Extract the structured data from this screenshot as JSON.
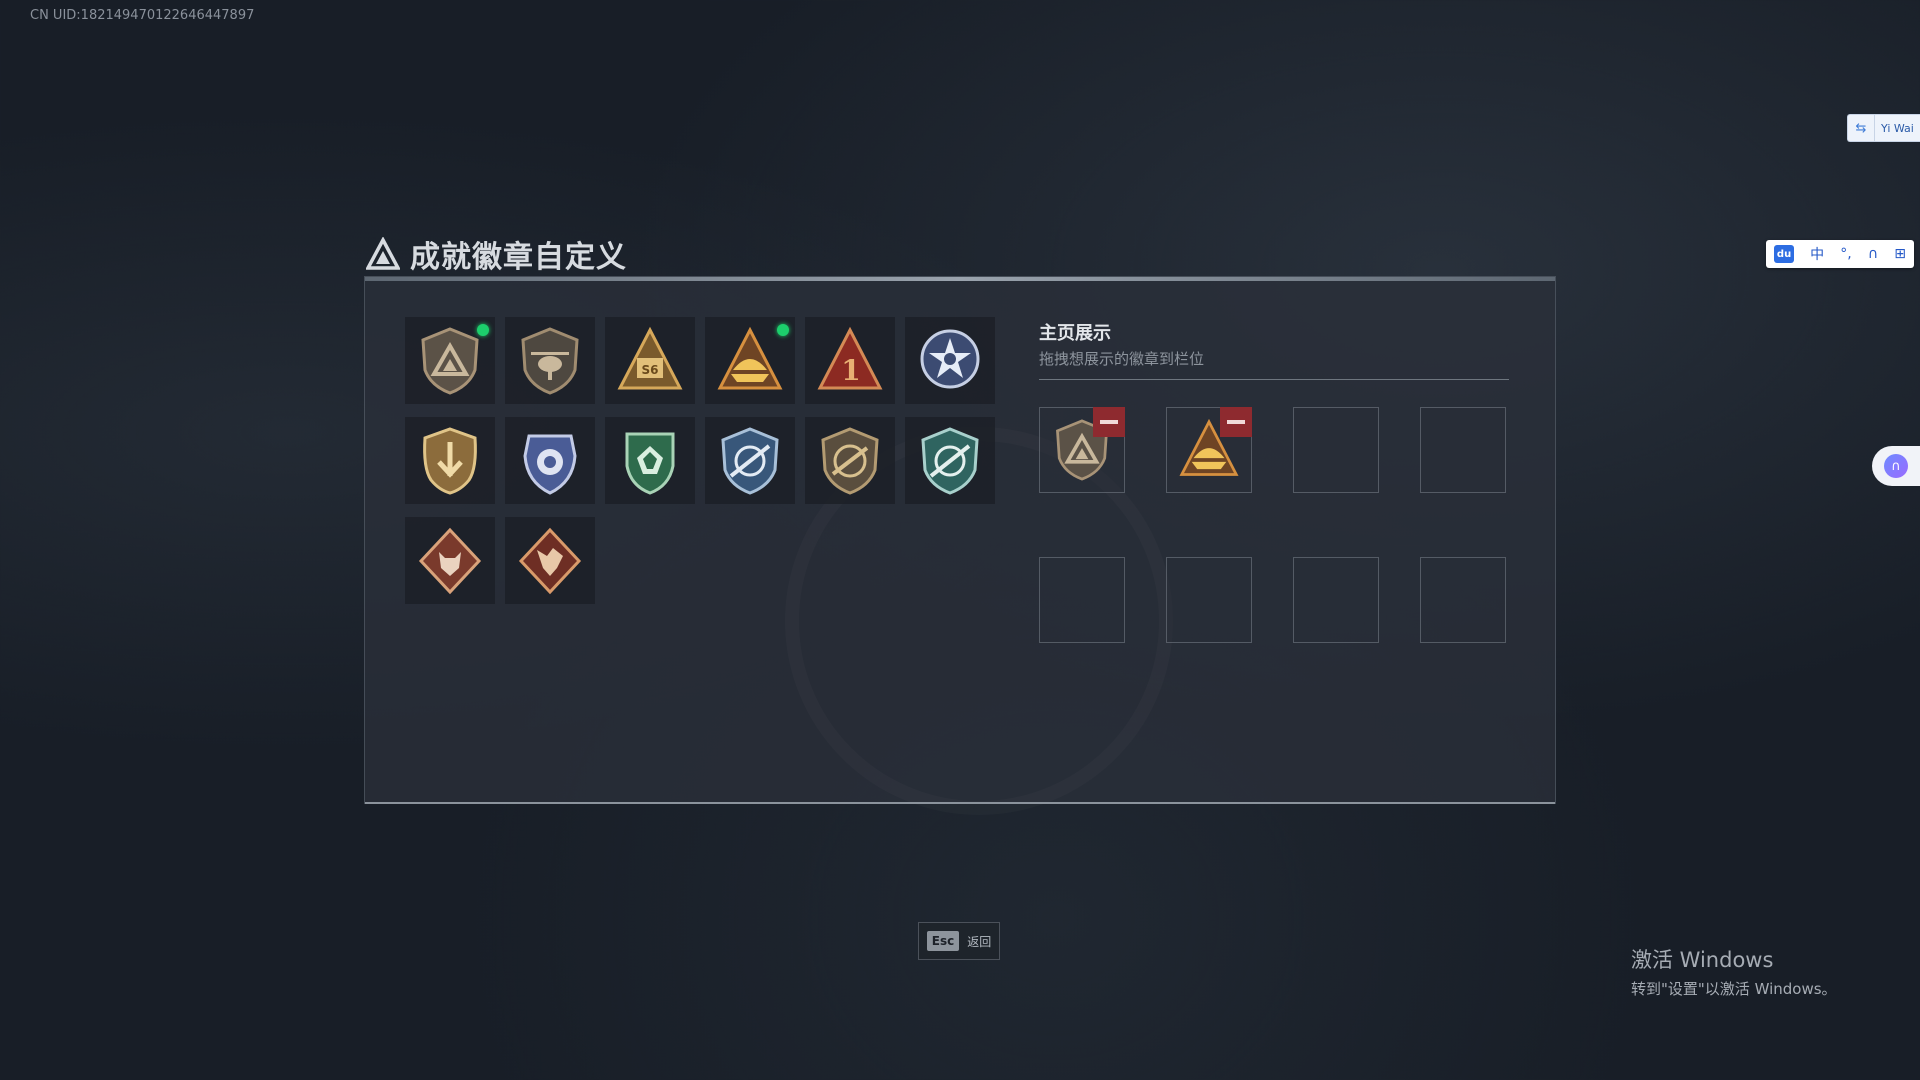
{
  "uid": "CN UID:182149470122646447897",
  "title": "成就徽章自定义",
  "side_widgets": {
    "translator_label": "Yi Wai",
    "ime_items": [
      "du",
      "中",
      "°,",
      "∩",
      "⊞"
    ]
  },
  "badges": [
    {
      "name": "badge-1",
      "icon": "bronze-shield-triangle",
      "is_new": true
    },
    {
      "name": "badge-2",
      "icon": "bronze-shield-helicopter",
      "is_new": false
    },
    {
      "name": "badge-3",
      "icon": "gold-triangle-s6",
      "is_new": false
    },
    {
      "name": "badge-4",
      "icon": "gold-triangle-ship",
      "is_new": true
    },
    {
      "name": "badge-5",
      "icon": "red-triangle-1",
      "is_new": false
    },
    {
      "name": "badge-6",
      "icon": "blue-star-medal",
      "is_new": false
    },
    {
      "name": "badge-7",
      "icon": "bronze-shield-arrow",
      "is_new": false
    },
    {
      "name": "badge-8",
      "icon": "blue-police-badge",
      "is_new": false
    },
    {
      "name": "badge-9",
      "icon": "green-gem-shield",
      "is_new": false
    },
    {
      "name": "badge-10",
      "icon": "blue-target-shield",
      "is_new": false
    },
    {
      "name": "badge-11",
      "icon": "bronze-rifle-shield",
      "is_new": false
    },
    {
      "name": "badge-12",
      "icon": "blue-target-shield-2",
      "is_new": false
    },
    {
      "name": "badge-13",
      "icon": "wolf-diamond",
      "is_new": false
    },
    {
      "name": "badge-14",
      "icon": "dragon-diamond",
      "is_new": false
    }
  ],
  "display": {
    "heading": "主页展示",
    "subheading": "拖拽想展示的徽章到栏位",
    "slots": [
      {
        "badge": "bronze-shield-triangle",
        "removable": true
      },
      {
        "badge": "gold-triangle-ship",
        "removable": true
      },
      {
        "badge": null,
        "removable": false
      },
      {
        "badge": null,
        "removable": false
      },
      {
        "badge": null,
        "removable": false
      },
      {
        "badge": null,
        "removable": false
      },
      {
        "badge": null,
        "removable": false
      },
      {
        "badge": null,
        "removable": false
      }
    ]
  },
  "esc": {
    "key": "Esc",
    "label": "返回"
  },
  "activation": {
    "line1": "激活 Windows",
    "line2": "转到\"设置\"以激活 Windows。"
  },
  "colors": {
    "new_dot": "#1ccf6c",
    "remove_button": "#8e2a2f",
    "panel": "#2a303a"
  }
}
